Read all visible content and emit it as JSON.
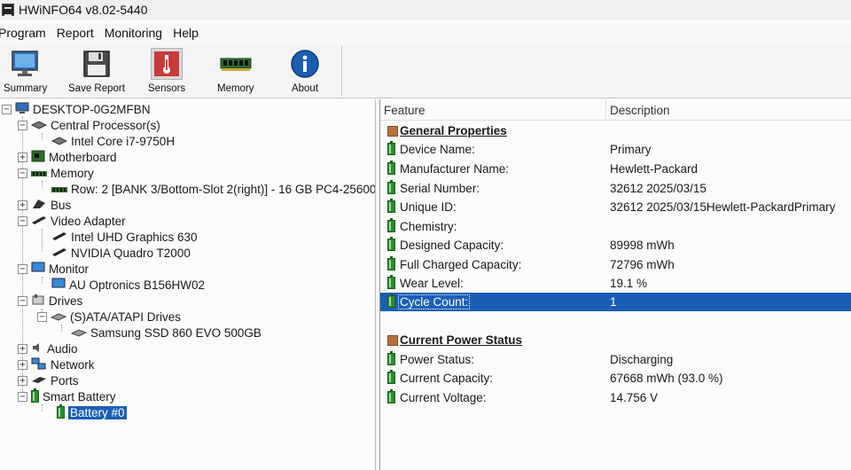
{
  "window": {
    "title": "HWiNFO64 v8.02-5440"
  },
  "menu": [
    "Program",
    "Report",
    "Monitoring",
    "Help"
  ],
  "toolbar": {
    "summary": "Summary",
    "save_report": "Save Report",
    "sensors": "Sensors",
    "memory": "Memory",
    "about": "About"
  },
  "tree": {
    "root": "DESKTOP-0G2MFBN",
    "cpu": "Central Processor(s)",
    "cpu_item": "Intel Core i7-9750H",
    "motherboard": "Motherboard",
    "memory": "Memory",
    "memory_item": "Row: 2 [BANK 3/Bottom-Slot 2(right)] - 16 GB PC4-25600",
    "bus": "Bus",
    "video": "Video Adapter",
    "video_item1": "Intel UHD Graphics 630",
    "video_item2": "NVIDIA Quadro T2000",
    "monitor": "Monitor",
    "monitor_item": "AU Optronics B156HW02",
    "drives": "Drives",
    "drives_sub": "(S)ATA/ATAPI Drives",
    "drive_item": "Samsung SSD 860 EVO 500GB",
    "audio": "Audio",
    "network": "Network",
    "ports": "Ports",
    "battery": "Smart Battery",
    "battery_item": "Battery #0"
  },
  "details": {
    "headers": {
      "feature": "Feature",
      "description": "Description"
    },
    "general_title": "General Properties",
    "general": [
      {
        "feature": "Device Name:",
        "value": "Primary"
      },
      {
        "feature": "Manufacturer Name:",
        "value": "Hewlett-Packard"
      },
      {
        "feature": "Serial Number:",
        "value": "32612 2025/03/15"
      },
      {
        "feature": "Unique ID:",
        "value": "32612 2025/03/15Hewlett-PackardPrimary"
      },
      {
        "feature": "Chemistry:",
        "value": ""
      },
      {
        "feature": "Designed Capacity:",
        "value": "89998 mWh"
      },
      {
        "feature": "Full Charged Capacity:",
        "value": "72796 mWh"
      },
      {
        "feature": "Wear Level:",
        "value": "19.1 %"
      },
      {
        "feature": "Cycle Count:",
        "value": "1"
      }
    ],
    "power_title": "Current Power Status",
    "power": [
      {
        "feature": "Power Status:",
        "value": "Discharging"
      },
      {
        "feature": "Current Capacity:",
        "value": "67668 mWh (93.0 %)"
      },
      {
        "feature": "Current Voltage:",
        "value": "14.756 V"
      }
    ]
  },
  "colors": {
    "selection": "#1a5fb4",
    "battery_green": "#2e8b2e"
  }
}
